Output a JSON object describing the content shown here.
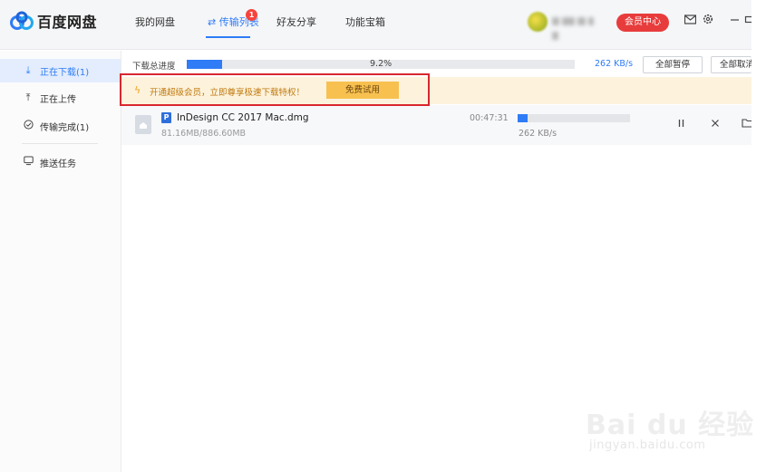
{
  "app": {
    "name": "百度网盘",
    "brand_color": "#2f7cf6",
    "logo_icon": "cloud-logo-icon"
  },
  "nav": {
    "tabs": [
      {
        "label": "我的网盘",
        "active": false
      },
      {
        "label": "⇄ 传输列表",
        "active": true,
        "badge": "1"
      },
      {
        "label": "好友分享",
        "active": false
      },
      {
        "label": "功能宝箱",
        "active": false
      }
    ]
  },
  "user": {
    "vip_label": "会员中心",
    "vip_color": "#e83c3c",
    "icons": [
      "mail-icon",
      "settings-icon",
      "minimize-icon",
      "maximize-icon"
    ]
  },
  "sidebar": {
    "items": [
      {
        "label": "正在下载(1)",
        "icon": "download-icon",
        "active": true
      },
      {
        "label": "正在上传",
        "icon": "upload-icon",
        "active": false
      },
      {
        "label": "传输完成(1)",
        "icon": "check-circle-icon",
        "active": false
      },
      {
        "label": "推送任务",
        "icon": "monitor-icon",
        "active": false
      }
    ]
  },
  "overall": {
    "label": "下载总进度",
    "percent_text": "9.2%",
    "progress": 0.092,
    "speed": "262 KB/s",
    "pause_all": "全部暂停",
    "cancel_all": "全部取消"
  },
  "banner": {
    "icon": "lightning-icon",
    "text": "开通超级会员，立即尊享极速下载特权！",
    "button": "免费试用"
  },
  "downloads": [
    {
      "badge": "P",
      "name": "InDesign CC 2017 Mac.dmg",
      "size": "81.16MB/886.60MB",
      "remaining": "00:47:31",
      "progress": 0.092,
      "speed": "262 KB/s",
      "actions": [
        "pause-icon",
        "close-icon",
        "folder-icon"
      ]
    }
  ],
  "watermark": {
    "main": "Bai du 经验",
    "sub": "jingyan.baidu.com"
  }
}
